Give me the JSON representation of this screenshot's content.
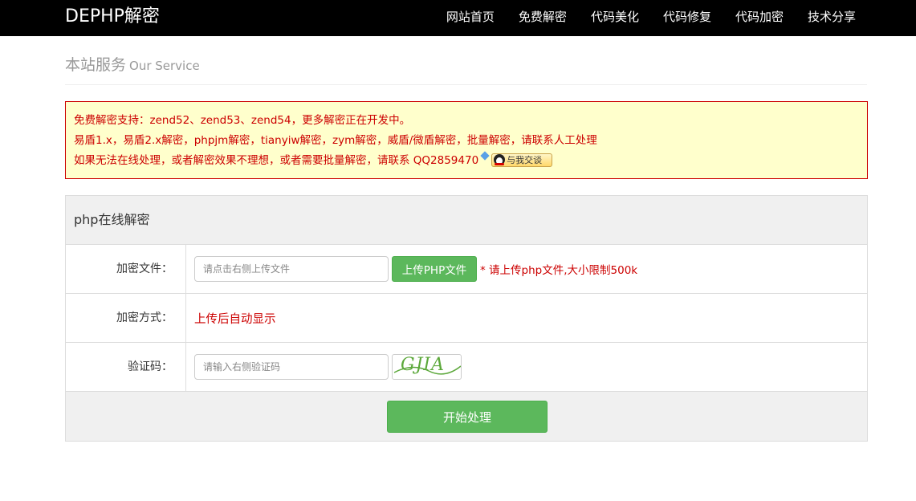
{
  "navbar": {
    "brand": "DEPHP解密",
    "items": [
      "网站首页",
      "免费解密",
      "代码美化",
      "代码修复",
      "代码加密",
      "技术分享"
    ]
  },
  "page_header": {
    "title": "本站服务",
    "subtitle": "Our Service"
  },
  "notice": {
    "line1": "免费解密支持：zend52、zend53、zend54，更多解密正在开发中。",
    "line2": "易盾1.x，易盾2.x解密，phpjm解密，tianyiw解密，zym解密，威盾/微盾解密，批量解密，请联系人工处理",
    "line3": "如果无法在线处理，或者解密效果不理想，或者需要批量解密，请联系 QQ2859470",
    "qq_button": "与我交谈"
  },
  "panel": {
    "heading": "php在线解密",
    "file_row": {
      "label": "加密文件：",
      "placeholder": "请点击右侧上传文件",
      "upload_button": "上传PHP文件",
      "hint": "* 请上传php文件,大小限制500k"
    },
    "method_row": {
      "label": "加密方式：",
      "value": "上传后自动显示"
    },
    "captcha_row": {
      "label": "验证码：",
      "placeholder": "请输入右侧验证码",
      "captcha_text": "GJIA"
    },
    "submit_button": "开始处理"
  },
  "colors": {
    "navbar_bg": "#000000",
    "notice_bg": "#ffffcc",
    "notice_text": "#cc0000",
    "button_green": "#5cb85c"
  }
}
